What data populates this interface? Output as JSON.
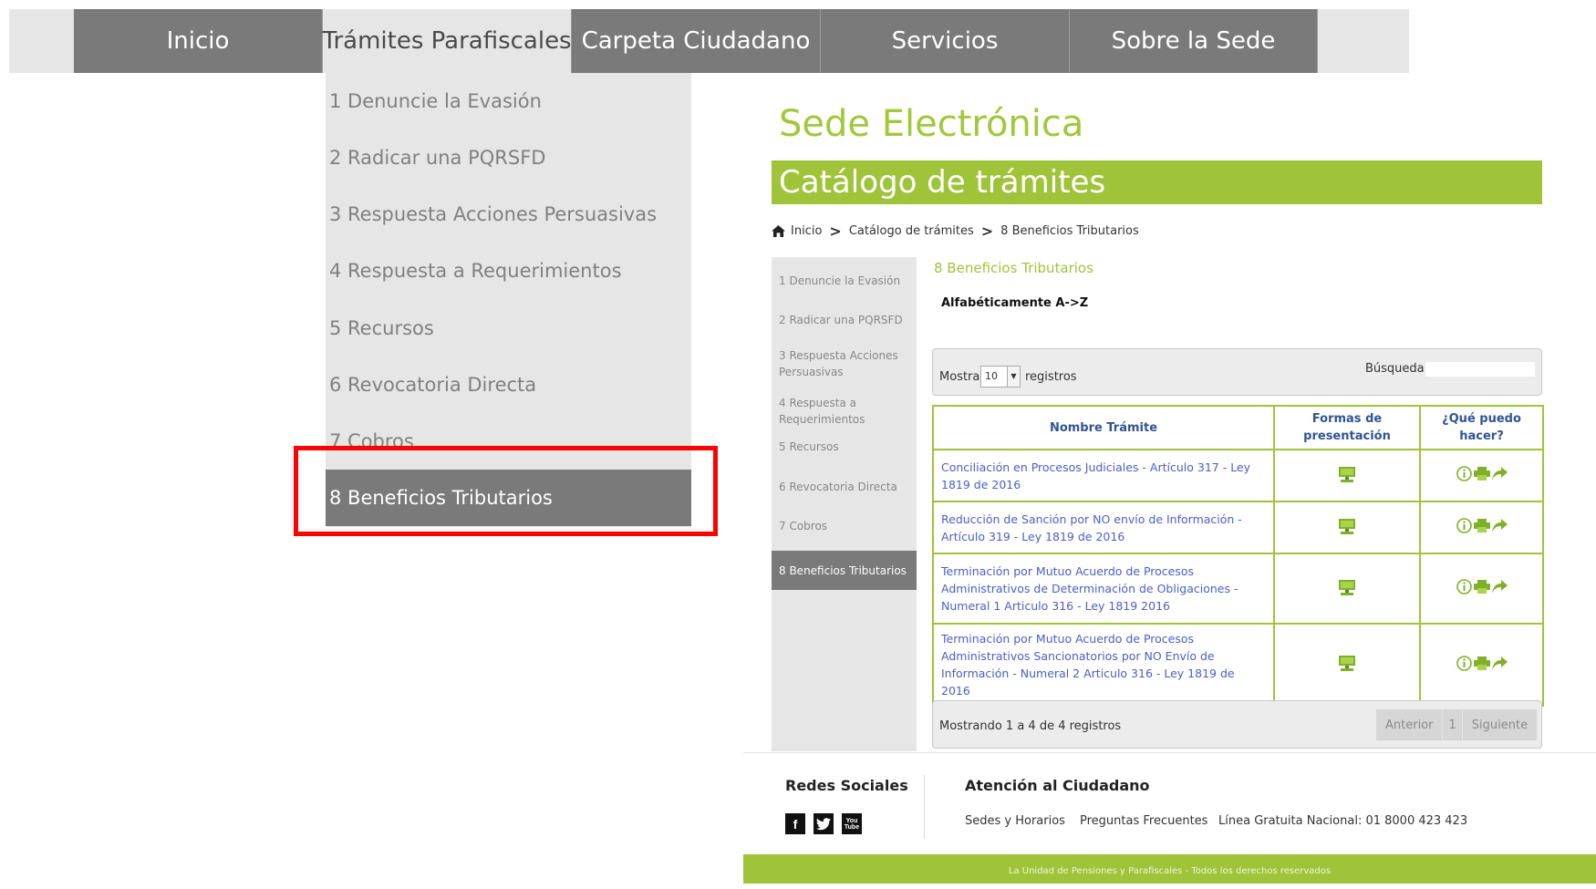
{
  "nav": {
    "items": [
      {
        "label": "Inicio"
      },
      {
        "label": "Trámites Parafiscales"
      },
      {
        "label": "Carpeta Ciudadano"
      },
      {
        "label": "Servicios"
      },
      {
        "label": "Sobre la Sede"
      }
    ],
    "active": "Trámites Parafiscales"
  },
  "dropdown": {
    "items": [
      {
        "label": "1 Denuncie la Evasión"
      },
      {
        "label": "2 Radicar una PQRSFD"
      },
      {
        "label": "3 Respuesta Acciones Persuasivas"
      },
      {
        "label": "4 Respuesta a Requerimientos"
      },
      {
        "label": "5 Recursos"
      },
      {
        "label": "6 Revocatoria Directa"
      },
      {
        "label": "7 Cobros"
      },
      {
        "label": "8 Beneficios Tributarios"
      }
    ],
    "selected": "8 Beneficios Tributarios"
  },
  "header": {
    "title": "Sede Electrónica",
    "banner": "Catálogo de trámites"
  },
  "breadcrumb": {
    "items": [
      "Inicio",
      "Catálogo de trámites",
      "8 Beneficios Tributarios"
    ],
    "separator": ">"
  },
  "sidemenu": {
    "items": [
      {
        "label": "1 Denuncie la Evasión"
      },
      {
        "label": "2 Radicar una PQRSFD"
      },
      {
        "label": "3 Respuesta Acciones Persuasivas"
      },
      {
        "label": "4 Respuesta a Requerimientos"
      },
      {
        "label": "5 Recursos"
      },
      {
        "label": "6 Revocatoria Directa"
      },
      {
        "label": "7 Cobros"
      },
      {
        "label": "8 Beneficios Tributarios"
      }
    ]
  },
  "content": {
    "section_heading": "8 Beneficios Tributarios",
    "alpha_sort": "Alfabéticamente A->Z",
    "controls": {
      "show_label": "Mostrar",
      "page_size": "10",
      "records_label": "registros",
      "search_label": "Búsqueda:",
      "search_value": ""
    },
    "table": {
      "headers": [
        "Nombre Trámite",
        "Formas de presentación",
        "¿Qué puedo hacer?"
      ],
      "rows": [
        {
          "name": "Conciliación en Procesos Judiciales - Artículo 317 - Ley 1819 de 2016"
        },
        {
          "name": "Reducción de Sanción por NO envío de Información - Artículo 319 - Ley 1819 de 2016"
        },
        {
          "name": "Terminación por Mutuo Acuerdo de Procesos Administrativos de Determinación de Obligaciones - Numeral 1 Articulo 316 - Ley 1819 2016"
        },
        {
          "name": "Terminación por Mutuo Acuerdo de Procesos Administrativos Sancionatorios por NO Envío de Información - Numeral 2 Articulo 316 - Ley 1819 de 2016"
        }
      ],
      "icons": {
        "presentation": "computer-icon",
        "actions": [
          "info-icon",
          "print-icon",
          "share-icon"
        ]
      }
    },
    "footer": {
      "info": "Mostrando 1 a 4 de 4 registros",
      "pager": {
        "prev": "Anterior",
        "page": "1",
        "next": "Siguiente"
      }
    }
  },
  "footer": {
    "redes_title": "Redes Sociales",
    "social": [
      {
        "icon": "facebook-icon",
        "glyph": "f"
      },
      {
        "icon": "twitter-icon",
        "glyph": "t"
      },
      {
        "icon": "youtube-icon",
        "glyph": "You Tube"
      }
    ],
    "atencion_title": "Atención al Ciudadano",
    "links": [
      "Sedes y Horarios",
      "Preguntas Frecuentes",
      "Línea Gratuita Nacional: 01 8000 423 423"
    ],
    "copyright": "La Unidad de Pensiones y Parafiscales - Todos los derechos reservados"
  },
  "colors": {
    "brand_green": "#9fc43a",
    "nav_gray": "#7a7a7a",
    "menu_bg": "#e6e6e6",
    "link_blue": "#4a5ec8",
    "highlight": "#ff0000"
  }
}
